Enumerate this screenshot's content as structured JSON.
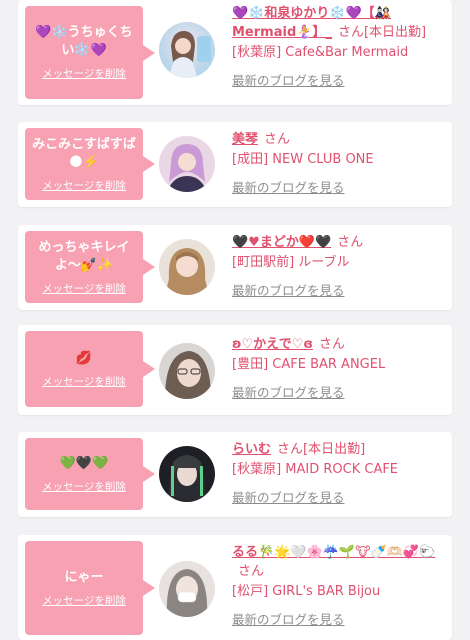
{
  "delete_label": "メッセージを削除",
  "blog_label": "最新のブログを見る",
  "san_label": "さん",
  "entries": [
    {
      "message": "💜❄️うちゅくちい❄️💜",
      "name": "💜❄️和泉ゆかり❄️💜【🎎Mermaid🧜‍♀️】",
      "name_suffix": "_",
      "working": "[本日出勤]",
      "shop": "[秋葉原] Cafe&Bar Mermaid"
    },
    {
      "message": "みこみこすばすば🌑⚡️",
      "name": "美琴",
      "name_suffix": "",
      "working": "",
      "shop": "[成田] NEW CLUB ONE"
    },
    {
      "message": "めっちゃキレイよ〜💅✨",
      "name": "🖤♥まどか❤️🖤",
      "name_suffix": "",
      "working": "",
      "shop": "[町田駅前] ルーブル"
    },
    {
      "message": "💋",
      "name": "ʚ♡かえで♡ɞ",
      "name_suffix": "",
      "working": "",
      "shop": "[豊田] CAFE BAR ANGEL"
    },
    {
      "message": "💚🖤💚",
      "name": "らいむ",
      "name_suffix": "",
      "working": "[本日出勤]",
      "shop": "[秋葉原] MAID ROCK CAFE"
    },
    {
      "message": "にゃー",
      "name": "るる🎋🌟🤍🌸☔️🌱🐮🍼🫶🏻💞🐑",
      "name_suffix": "",
      "working": "",
      "shop": "[松戸] GIRL's BAR Bijou"
    }
  ]
}
